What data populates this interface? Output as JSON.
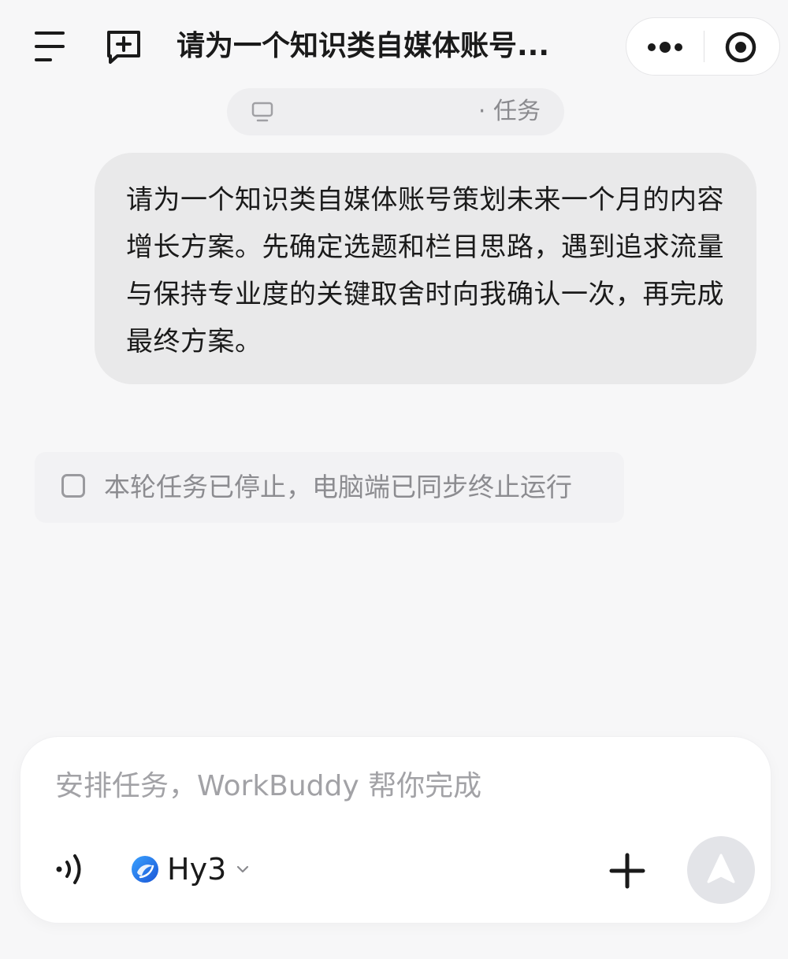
{
  "header": {
    "title": "请为一个知识类自媒体账号...",
    "menu_icon": "hamburger-menu-icon",
    "new_chat_icon": "new-chat-icon",
    "more_icon": "more-dots-icon",
    "close_icon": "target-close-icon"
  },
  "task_chip": {
    "icon": "monitor-icon",
    "label": "· 任务"
  },
  "user_message": {
    "text": "请为一个知识类自媒体账号策划未来一个月的内容增长方案。先确定选题和栏目思路，遇到追求流量与保持专业度的关键取舍时向我确认一次，再完成最终方案。"
  },
  "notice": {
    "text": "本轮任务已停止，电脑端已同步终止运行"
  },
  "composer": {
    "placeholder": "安排任务，WorkBuddy 帮你完成",
    "model_name": "Hy3",
    "voice_icon": "voice-wave-icon",
    "add_icon": "plus-icon",
    "send_icon": "send-arrow-icon"
  },
  "colors": {
    "page_bg": "#f7f7f8",
    "bubble_bg": "#e9e9ea",
    "send_button_bg": "#e3e4e8",
    "model_logo": "#1e6fe0"
  }
}
